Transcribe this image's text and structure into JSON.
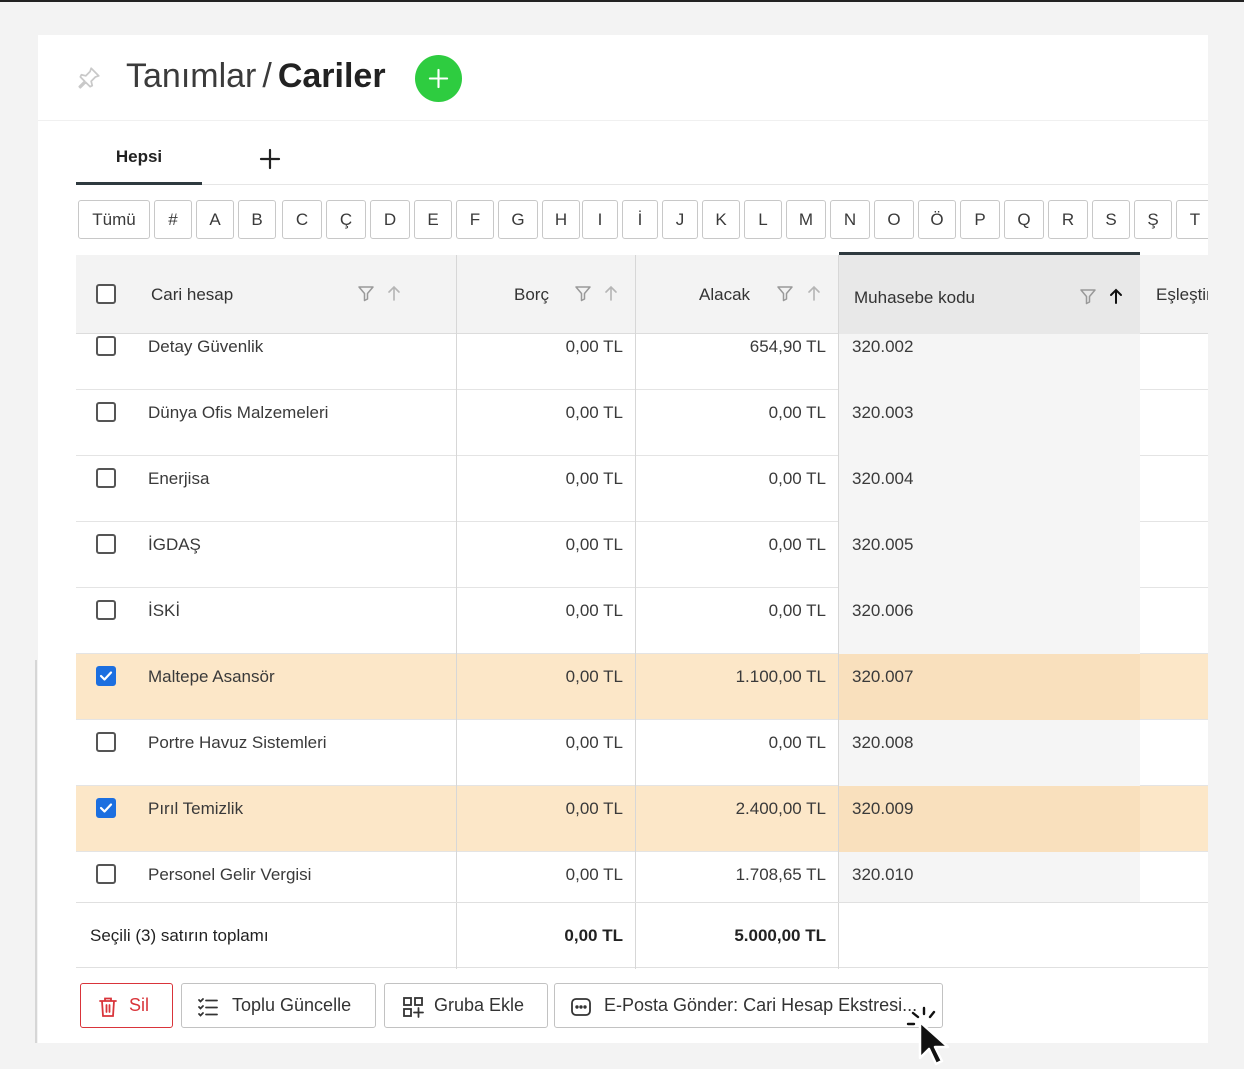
{
  "header": {
    "breadcrumb_parent": "Tanımlar",
    "separator": "/",
    "title": "Cariler"
  },
  "tabs": {
    "active": "Hepsi"
  },
  "letters": [
    "Tümü",
    "#",
    "A",
    "B",
    "C",
    "Ç",
    "D",
    "E",
    "F",
    "G",
    "H",
    "I",
    "İ",
    "J",
    "K",
    "L",
    "M",
    "N",
    "O",
    "Ö",
    "P",
    "Q",
    "R",
    "S",
    "Ş",
    "T"
  ],
  "columns": {
    "cari": "Cari hesap",
    "borc": "Borç",
    "alacak": "Alacak",
    "muhasebe": "Muhasebe kodu",
    "eslestirme": "Eşleştirme"
  },
  "rows": [
    {
      "name": "Detay Güvenlik",
      "borc": "0,00 TL",
      "alacak": "654,90 TL",
      "kod": "320.002",
      "checked": false
    },
    {
      "name": "Dünya Ofis Malzemeleri",
      "borc": "0,00 TL",
      "alacak": "0,00 TL",
      "kod": "320.003",
      "checked": false
    },
    {
      "name": "Enerjisa",
      "borc": "0,00 TL",
      "alacak": "0,00 TL",
      "kod": "320.004",
      "checked": false
    },
    {
      "name": "İGDAŞ",
      "borc": "0,00 TL",
      "alacak": "0,00 TL",
      "kod": "320.005",
      "checked": false
    },
    {
      "name": "İSKİ",
      "borc": "0,00 TL",
      "alacak": "0,00 TL",
      "kod": "320.006",
      "checked": false
    },
    {
      "name": "Maltepe Asansör",
      "borc": "0,00 TL",
      "alacak": "1.100,00 TL",
      "kod": "320.007",
      "checked": true
    },
    {
      "name": "Portre Havuz Sistemleri",
      "borc": "0,00 TL",
      "alacak": "0,00 TL",
      "kod": "320.008",
      "checked": false
    },
    {
      "name": "Pırıl Temizlik",
      "borc": "0,00 TL",
      "alacak": "2.400,00 TL",
      "kod": "320.009",
      "checked": true
    },
    {
      "name": "Personel Gelir Vergisi",
      "borc": "0,00 TL",
      "alacak": "1.708,65 TL",
      "kod": "320.010",
      "checked": false
    }
  ],
  "footer": {
    "label": "Seçili (3) satırın toplamı",
    "borc_total": "0,00 TL",
    "alacak_total": "5.000,00 TL"
  },
  "actions": {
    "delete": "Sil",
    "bulk_update": "Toplu Güncelle",
    "add_group": "Gruba Ekle",
    "email": "E-Posta Gönder: Cari Hesap Ekstresi..."
  },
  "colors": {
    "accent_green": "#2ecc40",
    "selected_row": "#fce7c8",
    "checkbox_blue": "#1c6fe0",
    "danger": "#d9343a"
  },
  "icons": [
    "pin-icon",
    "plus-icon",
    "filter-icon",
    "sort-up-icon",
    "trash-icon",
    "list-check-icon",
    "grid-add-icon",
    "message-icon",
    "cursor-icon"
  ]
}
